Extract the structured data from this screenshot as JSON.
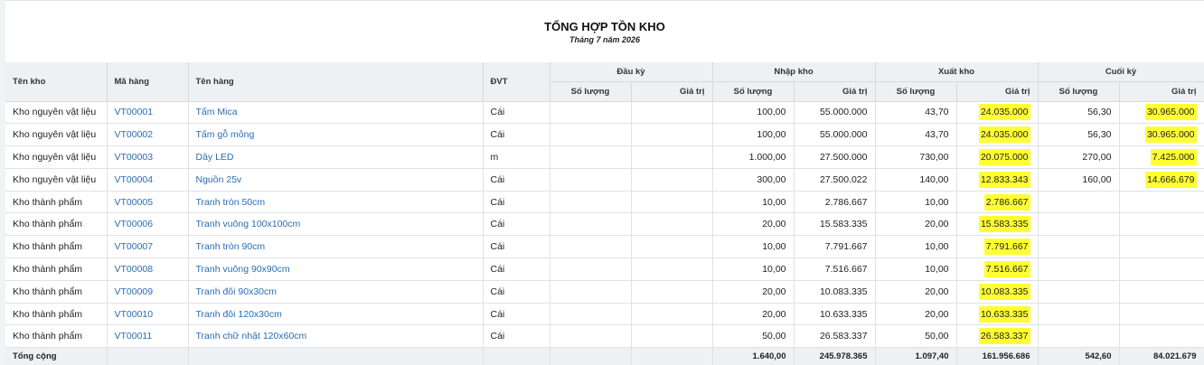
{
  "report": {
    "title": "TỔNG HỢP TỒN KHO",
    "subtitle": "Tháng 7 năm 2026"
  },
  "headers": {
    "warehouse": "Tên kho",
    "code": "Mã hàng",
    "name": "Tên hàng",
    "unit": "ĐVT",
    "groups": [
      "Đầu kỳ",
      "Nhập kho",
      "Xuất kho",
      "Cuối kỳ"
    ],
    "qty": "Số lượng",
    "value": "Giá trị"
  },
  "rows": [
    {
      "warehouse": "Kho nguyên vật liệu",
      "code": "VT00001",
      "name": "Tấm Mica",
      "unit": "Cái",
      "open_qty": "",
      "open_val": "",
      "in_qty": "100,00",
      "in_val": "55.000.000",
      "out_qty": "43,70",
      "out_val": "24.035.000",
      "end_qty": "56,30",
      "end_val": "30.965.000"
    },
    {
      "warehouse": "Kho nguyên vật liệu",
      "code": "VT00002",
      "name": "Tấm gỗ mỏng",
      "unit": "Cái",
      "open_qty": "",
      "open_val": "",
      "in_qty": "100,00",
      "in_val": "55.000.000",
      "out_qty": "43,70",
      "out_val": "24.035.000",
      "end_qty": "56,30",
      "end_val": "30.965.000"
    },
    {
      "warehouse": "Kho nguyên vật liệu",
      "code": "VT00003",
      "name": "Dây LED",
      "unit": "m",
      "open_qty": "",
      "open_val": "",
      "in_qty": "1.000,00",
      "in_val": "27.500.000",
      "out_qty": "730,00",
      "out_val": "20.075.000",
      "end_qty": "270,00",
      "end_val": "7.425.000"
    },
    {
      "warehouse": "Kho nguyên vật liệu",
      "code": "VT00004",
      "name": "Nguồn 25v",
      "unit": "Cái",
      "open_qty": "",
      "open_val": "",
      "in_qty": "300,00",
      "in_val": "27.500.022",
      "out_qty": "140,00",
      "out_val": "12.833.343",
      "end_qty": "160,00",
      "end_val": "14.666.679"
    },
    {
      "warehouse": "Kho thành phẩm",
      "code": "VT00005",
      "name": "Tranh tròn 50cm",
      "unit": "Cái",
      "open_qty": "",
      "open_val": "",
      "in_qty": "10,00",
      "in_val": "2.786.667",
      "out_qty": "10,00",
      "out_val": "2.786.667",
      "end_qty": "",
      "end_val": ""
    },
    {
      "warehouse": "Kho thành phẩm",
      "code": "VT00006",
      "name": "Tranh vuông 100x100cm",
      "unit": "Cái",
      "open_qty": "",
      "open_val": "",
      "in_qty": "20,00",
      "in_val": "15.583.335",
      "out_qty": "20,00",
      "out_val": "15.583.335",
      "end_qty": "",
      "end_val": ""
    },
    {
      "warehouse": "Kho thành phẩm",
      "code": "VT00007",
      "name": "Tranh tròn 90cm",
      "unit": "Cái",
      "open_qty": "",
      "open_val": "",
      "in_qty": "10,00",
      "in_val": "7.791.667",
      "out_qty": "10,00",
      "out_val": "7.791.667",
      "end_qty": "",
      "end_val": ""
    },
    {
      "warehouse": "Kho thành phẩm",
      "code": "VT00008",
      "name": "Tranh vuông 90x90cm",
      "unit": "Cái",
      "open_qty": "",
      "open_val": "",
      "in_qty": "10,00",
      "in_val": "7.516.667",
      "out_qty": "10,00",
      "out_val": "7.516.667",
      "end_qty": "",
      "end_val": ""
    },
    {
      "warehouse": "Kho thành phẩm",
      "code": "VT00009",
      "name": "Tranh đôi 90x30cm",
      "unit": "Cái",
      "open_qty": "",
      "open_val": "",
      "in_qty": "20,00",
      "in_val": "10.083.335",
      "out_qty": "20,00",
      "out_val": "10.083.335",
      "end_qty": "",
      "end_val": ""
    },
    {
      "warehouse": "Kho thành phẩm",
      "code": "VT00010",
      "name": "Tranh đôi 120x30cm",
      "unit": "Cái",
      "open_qty": "",
      "open_val": "",
      "in_qty": "20,00",
      "in_val": "10.633.335",
      "out_qty": "20,00",
      "out_val": "10.633.335",
      "end_qty": "",
      "end_val": ""
    },
    {
      "warehouse": "Kho thành phẩm",
      "code": "VT00011",
      "name": "Tranh chữ nhật 120x60cm",
      "unit": "Cái",
      "open_qty": "",
      "open_val": "",
      "in_qty": "50,00",
      "in_val": "26.583.337",
      "out_qty": "50,00",
      "out_val": "26.583.337",
      "end_qty": "",
      "end_val": ""
    }
  ],
  "total": {
    "label": "Tổng cộng",
    "in_qty": "1.640,00",
    "in_val": "245.978.365",
    "out_qty": "1.097,40",
    "out_val": "161.956.686",
    "end_qty": "542,60",
    "end_val": "84.021.679"
  },
  "colors": {
    "highlight": "#ffff33",
    "link": "#2a6db5",
    "header_bg": "#eef0f3"
  }
}
